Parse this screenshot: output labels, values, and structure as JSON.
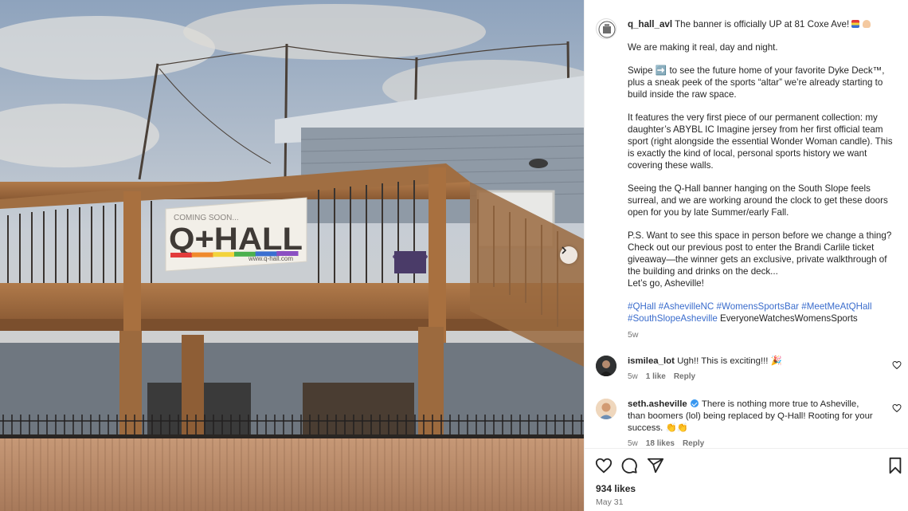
{
  "post": {
    "username": "q_hall_avl",
    "headline": "The banner is officially UP at 81 Coxe Ave!",
    "paragraphs": [
      "We are making it real, day and night.",
      "Swipe ➡️ to see the future home of your favorite Dyke Deck™, plus a sneak peek of the sports “altar” we’re already starting to build inside the raw space.",
      "It features the very first piece of our permanent collection: my daughter’s ABYBL IC Imagine jersey from her first official team sport (right alongside the essential Wonder Woman candle). This is exactly the kind of local, personal sports history we want covering these walls.",
      "Seeing the Q-Hall banner hanging on the South Slope feels surreal, and we are working around the clock to get these doors open for you by late Summer/early Fall."
    ],
    "ps_lines": [
      "P.S. Want to see this space in person before we change a thing? Check out our previous post to enter the Brandi Carlile ticket giveaway—the winner gets an exclusive, private walkthrough of the building and drinks on the deck...",
      "Let’s go, Asheville!"
    ],
    "hashtags": [
      "#QHall",
      "#AshevilleNC",
      "#WomensSportsBar",
      "#MeetMeAtQHall",
      "#SouthSlopeAsheville"
    ],
    "trailing_tag": "EveryoneWatchesWomensSports",
    "age": "5w",
    "likes": "934 likes",
    "date": "May 31"
  },
  "banner": {
    "top_text": "COMING SOON...",
    "main_text": "Q+HALL",
    "url_text": "www.q-hall.com",
    "rainbow": [
      "#e23b3b",
      "#f08a2c",
      "#f2d33b",
      "#4bb04e",
      "#3a6fd0",
      "#8b4fc2"
    ]
  },
  "comments": [
    {
      "username": "ismilea_lot",
      "text": "Ugh!! This is exciting!!! 🎉",
      "age": "5w",
      "likes": "1 like",
      "reply": "Reply",
      "verified": false
    },
    {
      "username": "seth.asheville",
      "text": "There is nothing more true to Asheville, than boomers (lol) being replaced by Q-Hall! Rooting for your success. 👏👏",
      "age": "5w",
      "likes": "18 likes",
      "reply": "Reply",
      "verified": true
    }
  ],
  "icons": {
    "like": "heart-icon",
    "comment": "comment-icon",
    "share": "share-icon",
    "save": "bookmark-icon",
    "next": "chevron-right-icon"
  },
  "colors": {
    "link": "#3a6ccc",
    "muted": "#737373",
    "text": "#262626"
  }
}
